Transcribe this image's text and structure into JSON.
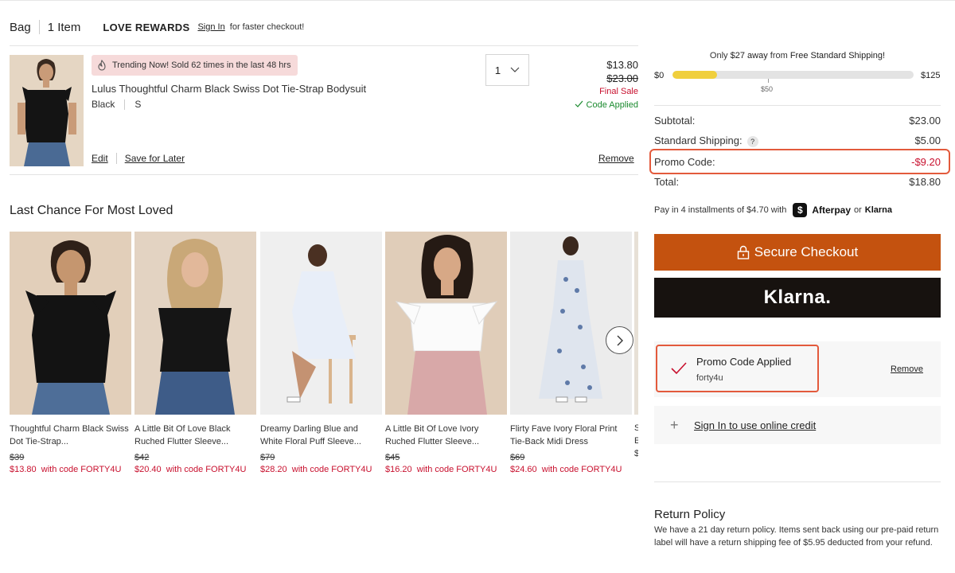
{
  "header": {
    "bag_label": "Bag",
    "item_count": "1 Item",
    "rewards_brand": "LOVE REWARDS",
    "signin_link": "Sign In",
    "signin_suffix": "for faster checkout!"
  },
  "bag_item": {
    "badge": "Trending Now! Sold 62 times in the last 48 hrs",
    "name": "Lulus Thoughtful Charm Black Swiss Dot Tie-Strap Bodysuit",
    "color": "Black",
    "size": "S",
    "quantity": "1",
    "price_now": "$13.80",
    "price_was": "$23.00",
    "final_sale": "Final Sale",
    "code_applied": "Code Applied",
    "edit_label": "Edit",
    "save_label": "Save for Later",
    "remove_label": "Remove"
  },
  "carousel": {
    "title": "Last Chance For Most Loved",
    "products": [
      {
        "name": "Thoughtful Charm Black Swiss Dot Tie-Strap...",
        "was": "$39",
        "now": "$13.80",
        "code": "with code FORTY4U"
      },
      {
        "name": "A Little Bit Of Love Black Ruched Flutter Sleeve...",
        "was": "$42",
        "now": "$20.40",
        "code": "with code FORTY4U"
      },
      {
        "name": "Dreamy Darling Blue and White Floral Puff Sleeve...",
        "was": "$79",
        "now": "$28.20",
        "code": "with code FORTY4U"
      },
      {
        "name": "A Little Bit Of Love Ivory Ruched Flutter Sleeve...",
        "was": "$45",
        "now": "$16.20",
        "code": "with code FORTY4U"
      },
      {
        "name": "Flirty Fave Ivory Floral Print Tie-Back Midi Dress",
        "was": "$69",
        "now": "$24.60",
        "code": "with code FORTY4U"
      }
    ],
    "partial_text": "S\nE\n$"
  },
  "shipping": {
    "msg_prefix": "Only",
    "msg_amount": "$27 away",
    "msg_mid": "from",
    "msg_suffix": "Free Standard Shipping!",
    "min_label": "$0",
    "mid_label": "$50",
    "max_label": "$125",
    "progress_fraction": 0.184
  },
  "summary": {
    "subtotal_label": "Subtotal:",
    "subtotal_value": "$23.00",
    "shipping_label": "Standard Shipping:",
    "shipping_help": "?",
    "shipping_value": "$5.00",
    "promo_label": "Promo Code:",
    "promo_value": "-$9.20",
    "total_label": "Total:",
    "total_value": "$18.80"
  },
  "installments": {
    "text": "Pay in 4 installments of $4.70 with",
    "afterpay": "Afterpay",
    "or": "or",
    "klarna": "Klarna"
  },
  "buttons": {
    "checkout": "Secure Checkout",
    "klarna": "Klarna."
  },
  "promo": {
    "title": "Promo Code Applied",
    "code": "forty4u",
    "remove": "Remove"
  },
  "credit": {
    "link": "Sign In to use online credit"
  },
  "return_policy": {
    "title": "Return Policy",
    "text": "We have a 21 day return policy. Items sent back using our pre-paid return label will have a return shipping fee of $5.95 deducted from your refund."
  },
  "colors": {
    "accent_orange": "#c4520f",
    "sale_red": "#c8102e",
    "applied_green": "#1a8a2e",
    "progress_yellow": "#f0cf3c",
    "highlight": "#e35a3c"
  }
}
